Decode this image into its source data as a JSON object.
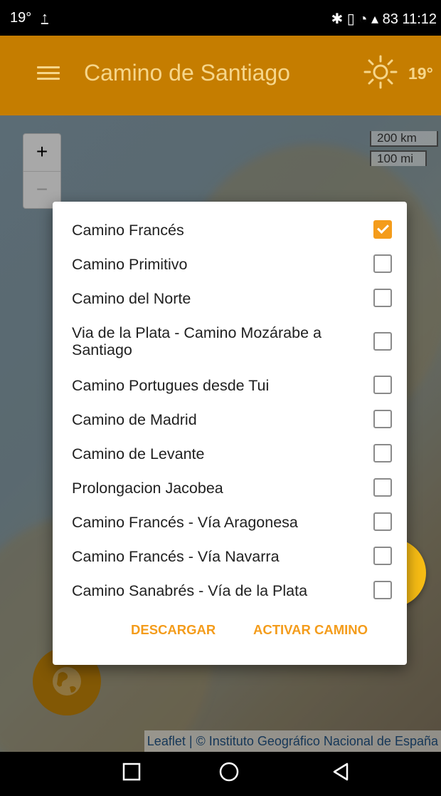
{
  "status_bar": {
    "left_text": "19°",
    "right_text": "83 11:12",
    "icons": [
      "upload-icon",
      "bluetooth-icon",
      "vibrate-icon",
      "wifi-icon",
      "signal-icon",
      "battery-icon"
    ]
  },
  "app_bar": {
    "title": "Camino de Santiago",
    "temperature": "19°",
    "weather_icon": "sun-icon",
    "menu_icon": "hamburger-menu-icon",
    "background_color": "#c57d00",
    "text_color": "#f6d68a"
  },
  "map": {
    "zoom_in": "+",
    "zoom_out": "−",
    "scale_km": "200 km",
    "scale_mi": "100 mi",
    "attribution_leaflet": "Leaflet",
    "attribution_separator": " | © ",
    "attribution_source": "Instituto Geográfico Nacional de España"
  },
  "dialog": {
    "routes": [
      {
        "label": "Camino Francés",
        "checked": true
      },
      {
        "label": "Camino Primitivo",
        "checked": false
      },
      {
        "label": "Camino del Norte",
        "checked": false
      },
      {
        "label": "Via de la Plata - Camino Mozárabe a Santiago",
        "checked": false
      },
      {
        "label": "Camino Portugues desde Tui",
        "checked": false
      },
      {
        "label": "Camino de Madrid",
        "checked": false
      },
      {
        "label": "Camino de Levante",
        "checked": false
      },
      {
        "label": "Prolongacion Jacobea",
        "checked": false
      },
      {
        "label": "Camino Francés - Vía Aragonesa",
        "checked": false
      },
      {
        "label": "Camino Francés - Vía Navarra",
        "checked": false
      },
      {
        "label": "Camino Sanabrés - Vía de la Plata",
        "checked": false
      }
    ],
    "download_label": "DESCARGAR",
    "activate_label": "ACTIVAR CAMINO",
    "accent_color": "#f49c1b"
  },
  "fabs": {
    "globe_icon": "globe-icon",
    "navigate_icon": "navigation-arrow-icon",
    "navigate_color": "#f7bc14"
  },
  "nav_bar": {
    "icons": [
      "recents-square-icon",
      "home-circle-icon",
      "back-triangle-icon"
    ]
  }
}
